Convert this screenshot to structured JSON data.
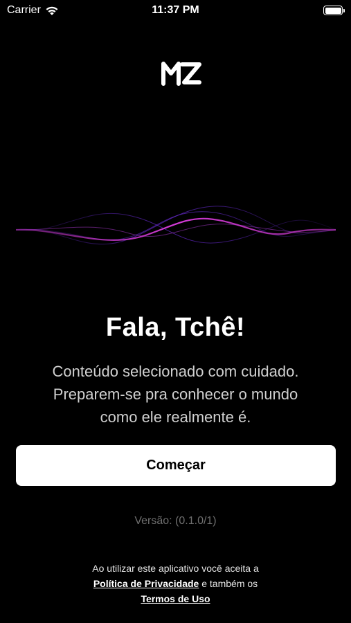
{
  "status_bar": {
    "carrier": "Carrier",
    "time": "11:37 PM",
    "icons": [
      "wifi-icon",
      "battery-icon"
    ]
  },
  "logo": {
    "text": "MZ"
  },
  "main": {
    "title": "Fala, Tchê!",
    "description_lines": [
      "Conteúdo selecionado com cuidado.",
      "Preparem-se pra conhecer o mundo",
      "como ele realmente é."
    ],
    "start_label": "Começar",
    "version": "Versão: (0.1.0/1)"
  },
  "legal": {
    "prefix": "Ao utilizar este aplicativo você aceita a",
    "privacy_link": "Política de Privacidade",
    "middle": "e também os",
    "terms_link": "Termos de Uso"
  },
  "colors": {
    "background": "#000000",
    "wave_primary": "#d43bd8",
    "wave_secondary": "#6a2bd6",
    "button_bg": "#ffffff"
  }
}
